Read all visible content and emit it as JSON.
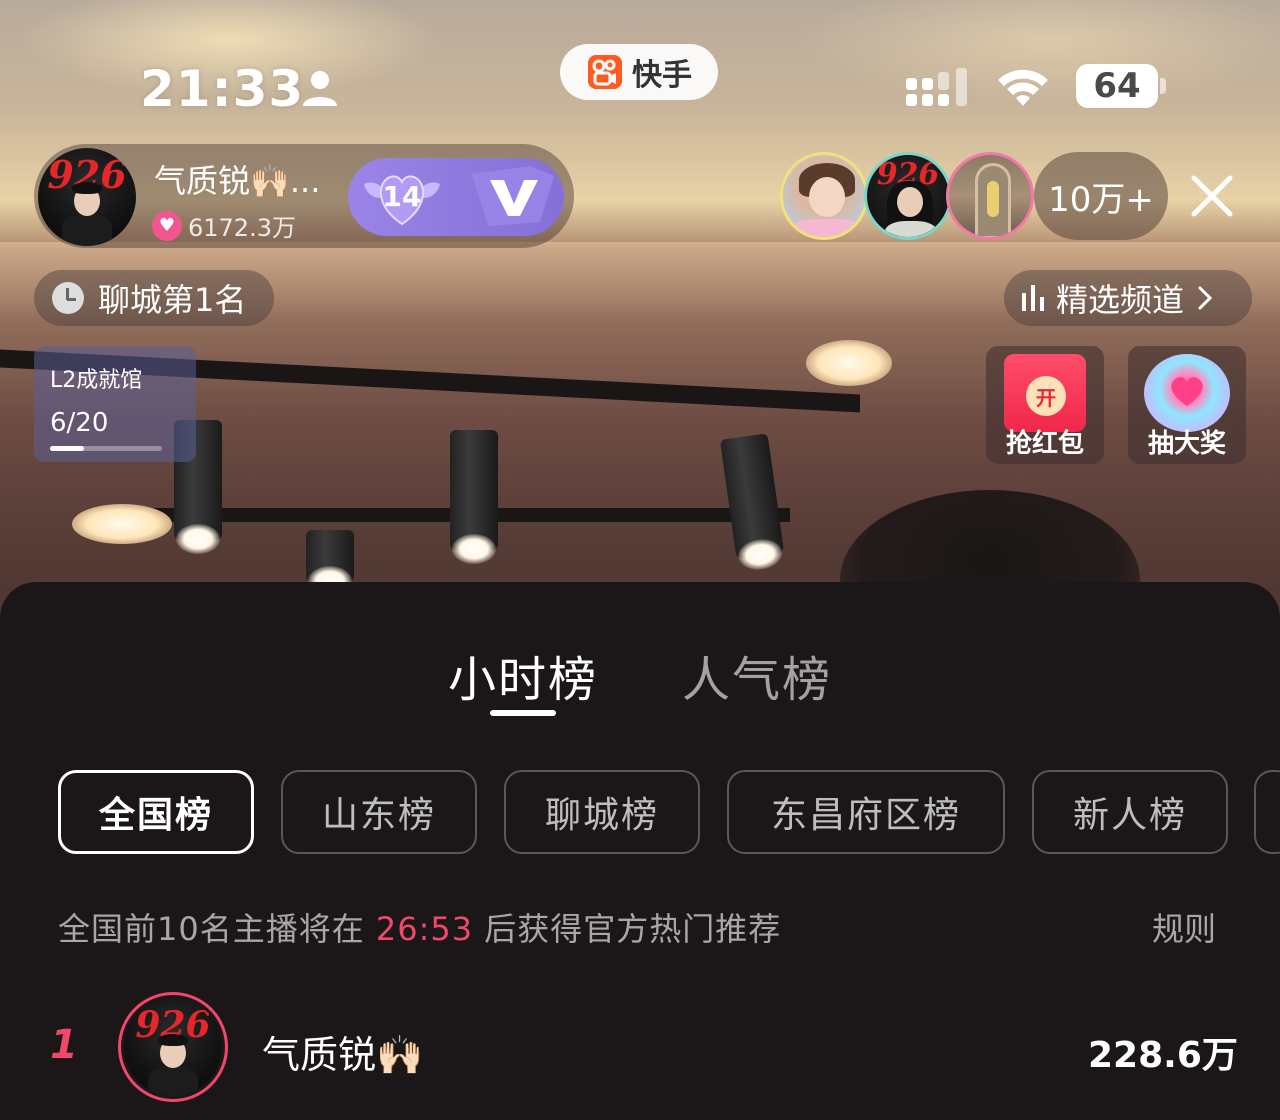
{
  "status_bar": {
    "time": "21:33",
    "app_name": "快手",
    "battery": "64"
  },
  "host": {
    "avatar_text": "926",
    "name": "气质锐🙌🏻...",
    "likes": "6172.3万",
    "level": "14"
  },
  "viewers": {
    "count": "10万+",
    "avatar_text": "926"
  },
  "city_rank": "聊城第1名",
  "channel": "精选频道",
  "achievement": {
    "title": "L2成就馆",
    "progress_text": "6/20",
    "progress_fraction": 0.3
  },
  "actions": {
    "red_packet_coin": "开",
    "red_packet_label": "抢红包",
    "lottery_label": "抽大奖"
  },
  "leaderboard": {
    "tabs": [
      {
        "label": "小时榜",
        "active": true
      },
      {
        "label": "人气榜",
        "active": false
      }
    ],
    "filters": [
      {
        "label": "全国榜",
        "active": true
      },
      {
        "label": "山东榜",
        "active": false
      },
      {
        "label": "聊城榜",
        "active": false
      },
      {
        "label": "东昌府区榜",
        "active": false
      },
      {
        "label": "新人榜",
        "active": false
      }
    ],
    "notice": {
      "prefix": "全国前10名主播将在",
      "countdown": "26:53",
      "suffix": "后获得官方热门推荐"
    },
    "rules_label": "规则",
    "rows": [
      {
        "rank": "1",
        "avatar_text": "926",
        "name": "气质锐🙌🏻",
        "score": "228.6万"
      }
    ]
  },
  "colors": {
    "accent_pink": "#f2476a",
    "level_purple": "#8470d8",
    "sheet_bg": "#1b1719"
  }
}
